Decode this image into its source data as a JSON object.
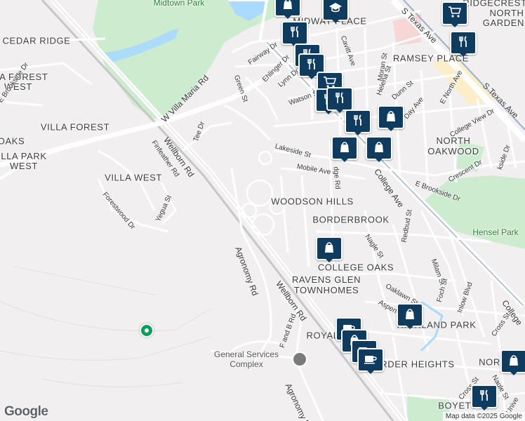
{
  "map": {
    "neighborhoods": [
      {
        "id": "cedar-ridge",
        "text": "CEDAR RIDGE"
      },
      {
        "id": "villa-forest-west",
        "text": "LLA FOREST\nWEST"
      },
      {
        "id": "villa-forest",
        "text": "VILLA FOREST"
      },
      {
        "id": "oaks",
        "text": "OAKS"
      },
      {
        "id": "villa-park-west",
        "text": "LLA PARK\nWEST"
      },
      {
        "id": "villa-west",
        "text": "VILLA WEST"
      },
      {
        "id": "midway-place",
        "text": "MIDWAY PLACE"
      },
      {
        "id": "ridgecrest",
        "text": "RIDGECREST"
      },
      {
        "id": "north-gardens",
        "text": "NORTH\nGARDENS"
      },
      {
        "id": "ramsey-place",
        "text": "RAMSEY PLACE"
      },
      {
        "id": "north-oakwood",
        "text": "NORTH\nOAKWOOD"
      },
      {
        "id": "woodson-hills",
        "text": "WOODSON HILLS"
      },
      {
        "id": "borderbrook",
        "text": "BORDERBROOK"
      },
      {
        "id": "college-oaks",
        "text": "COLLEGE OAKS"
      },
      {
        "id": "ravens-glen",
        "text": "RAVENS GLEN\nTOWNHOMES"
      },
      {
        "id": "highland-park",
        "text": "HIGHLAND PARK"
      },
      {
        "id": "royal",
        "text": "ROYAL OAK"
      },
      {
        "id": "border-heights",
        "text": "BORDER HEIGHTS"
      },
      {
        "id": "northo",
        "text": "NORTHO"
      },
      {
        "id": "boyett",
        "text": "BOYETT"
      }
    ],
    "parks": [
      {
        "id": "midtown-park",
        "text": "Midtown Park"
      },
      {
        "id": "hensel-park",
        "text": "Hensel Park"
      }
    ],
    "roads": [
      {
        "id": "w-villa-maria",
        "text": "W Villa Maria Rd"
      },
      {
        "id": "wellborn-1",
        "text": "Wellborn Rd"
      },
      {
        "id": "wellborn-2",
        "text": "Wellborn Rd"
      },
      {
        "id": "finfeather",
        "text": "Finfeather Rd"
      },
      {
        "id": "tee",
        "text": "Tee Dr"
      },
      {
        "id": "fairway",
        "text": "Fairway Dr"
      },
      {
        "id": "green",
        "text": "Green St"
      },
      {
        "id": "ehlinger",
        "text": "Ehlinger Dr"
      },
      {
        "id": "lynn",
        "text": "Lynn Dr"
      },
      {
        "id": "watson",
        "text": "Watson St"
      },
      {
        "id": "cavitt",
        "text": "Cavitt Ave"
      },
      {
        "id": "moran",
        "text": "Moran St"
      },
      {
        "id": "helena",
        "text": "Helena St"
      },
      {
        "id": "dunn",
        "text": "Dunn St"
      },
      {
        "id": "day",
        "text": "Day Ave"
      },
      {
        "id": "e-north",
        "text": "E North Ave"
      },
      {
        "id": "s-texas-1",
        "text": "S Texas Ave"
      },
      {
        "id": "s-texas-2",
        "text": "S Texas Ave"
      },
      {
        "id": "college-view",
        "text": "College View Dr"
      },
      {
        "id": "e-brookside",
        "text": "E Brookside Dr"
      },
      {
        "id": "e-brookside-2",
        "text": "E Brookside Dr"
      },
      {
        "id": "crescent",
        "text": "Crescent Dr"
      },
      {
        "id": "lakeside",
        "text": "Lakeside St"
      },
      {
        "id": "mobile",
        "text": "Mobile Ave"
      },
      {
        "id": "edge",
        "text": "dge Rd"
      },
      {
        "id": "college-ave",
        "text": "College Ave"
      },
      {
        "id": "college-2",
        "text": "College"
      },
      {
        "id": "forestwood",
        "text": "Forestwood Dr"
      },
      {
        "id": "yegua",
        "text": "Yegua St"
      },
      {
        "id": "agronomy-1",
        "text": "Agronomy Rd"
      },
      {
        "id": "agronomy-2",
        "text": "Agronomy Rd"
      },
      {
        "id": "f-and-b",
        "text": "F and B Rd"
      },
      {
        "id": "nagle",
        "text": "Nagle St"
      },
      {
        "id": "nagle-2",
        "text": "Nagle St"
      },
      {
        "id": "redbud",
        "text": "Redbud St"
      },
      {
        "id": "milam",
        "text": "Milam St"
      },
      {
        "id": "foch",
        "text": "Foch St"
      },
      {
        "id": "inlow",
        "text": "Inlow Blvd"
      },
      {
        "id": "oaklawn",
        "text": "Oaklawn St"
      },
      {
        "id": "aspen",
        "text": "Aspen St"
      },
      {
        "id": "cross",
        "text": "Cross St"
      },
      {
        "id": "cross-2",
        "text": "Cross St"
      },
      {
        "id": "univ",
        "text": "Unive"
      },
      {
        "id": "bside-dr",
        "text": "kside Dr"
      }
    ],
    "pois": [
      {
        "id": "gsc",
        "text": "General Services\nComplex"
      }
    ],
    "markers": [
      {
        "id": "m1",
        "icon": "shopping-bag-icon"
      },
      {
        "id": "m2",
        "icon": "restaurant-icon"
      },
      {
        "id": "m3",
        "icon": "school-icon"
      },
      {
        "id": "m4",
        "icon": "restaurant-icon"
      },
      {
        "id": "m5",
        "icon": "restaurant-icon"
      },
      {
        "id": "m6",
        "icon": "shopping-cart-icon"
      },
      {
        "id": "m7",
        "icon": "restaurant-icon"
      },
      {
        "id": "m8",
        "icon": "restaurant-icon"
      },
      {
        "id": "m9",
        "icon": "restaurant-icon"
      },
      {
        "id": "m10",
        "icon": "shopping-bag-icon"
      },
      {
        "id": "m11",
        "icon": "shopping-bag-icon"
      },
      {
        "id": "m12",
        "icon": "shopping-bag-icon"
      },
      {
        "id": "m13",
        "icon": "shopping-cart-icon"
      },
      {
        "id": "m14",
        "icon": "restaurant-icon"
      },
      {
        "id": "m15",
        "icon": "shopping-bag-icon"
      },
      {
        "id": "m16",
        "icon": "shopping-bag-icon"
      },
      {
        "id": "m17",
        "icon": "coffee-icon"
      },
      {
        "id": "m18",
        "icon": "shopping-bag-icon"
      },
      {
        "id": "m19",
        "icon": "coffee-icon"
      },
      {
        "id": "m20",
        "icon": "coffee-icon"
      },
      {
        "id": "m21",
        "icon": "shopping-bag-icon"
      },
      {
        "id": "m22",
        "icon": "restaurant-icon"
      }
    ],
    "logo": "Google",
    "attribution": "Map data ©2025 Google",
    "colors": {
      "park": "#cdeccf",
      "marker": "#0f3b5f",
      "road": "#ffffff",
      "rail": "#b8b8b8",
      "water": "#aadaff"
    }
  }
}
